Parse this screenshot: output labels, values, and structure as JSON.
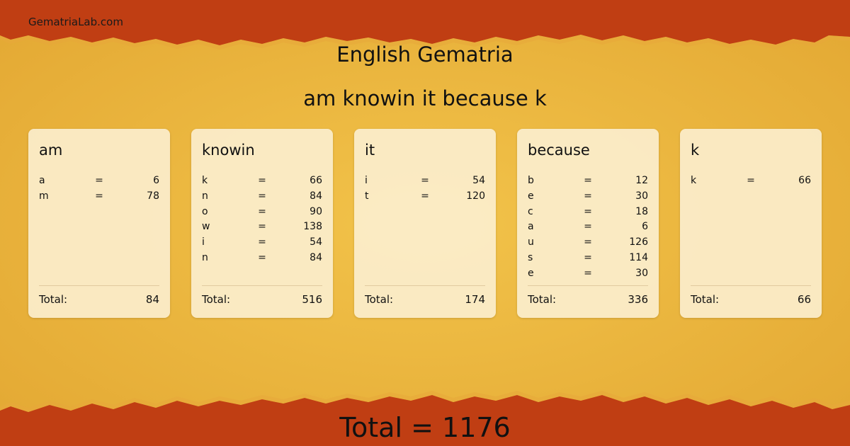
{
  "site": "GematriaLab.com",
  "heading": "English Gematria",
  "phrase": "am knowin it because k",
  "total_label": "Total:",
  "words": [
    {
      "word": "am",
      "letters": [
        {
          "ch": "a",
          "eq": "=",
          "val": "6"
        },
        {
          "ch": "m",
          "eq": "=",
          "val": "78"
        }
      ],
      "total": "84"
    },
    {
      "word": "knowin",
      "letters": [
        {
          "ch": "k",
          "eq": "=",
          "val": "66"
        },
        {
          "ch": "n",
          "eq": "=",
          "val": "84"
        },
        {
          "ch": "o",
          "eq": "=",
          "val": "90"
        },
        {
          "ch": "w",
          "eq": "=",
          "val": "138"
        },
        {
          "ch": "i",
          "eq": "=",
          "val": "54"
        },
        {
          "ch": "n",
          "eq": "=",
          "val": "84"
        }
      ],
      "total": "516"
    },
    {
      "word": "it",
      "letters": [
        {
          "ch": "i",
          "eq": "=",
          "val": "54"
        },
        {
          "ch": "t",
          "eq": "=",
          "val": "120"
        }
      ],
      "total": "174"
    },
    {
      "word": "because",
      "letters": [
        {
          "ch": "b",
          "eq": "=",
          "val": "12"
        },
        {
          "ch": "e",
          "eq": "=",
          "val": "30"
        },
        {
          "ch": "c",
          "eq": "=",
          "val": "18"
        },
        {
          "ch": "a",
          "eq": "=",
          "val": "6"
        },
        {
          "ch": "u",
          "eq": "=",
          "val": "126"
        },
        {
          "ch": "s",
          "eq": "=",
          "val": "114"
        },
        {
          "ch": "e",
          "eq": "=",
          "val": "30"
        }
      ],
      "total": "336"
    },
    {
      "word": "k",
      "letters": [
        {
          "ch": "k",
          "eq": "=",
          "val": "66"
        }
      ],
      "total": "66"
    }
  ],
  "grand_total": "Total = 1176",
  "colors": {
    "banner": "#c03e13",
    "banner_dark": "#9c2f0d",
    "paper": "#e9b53d",
    "card": "#fcf0d4"
  }
}
